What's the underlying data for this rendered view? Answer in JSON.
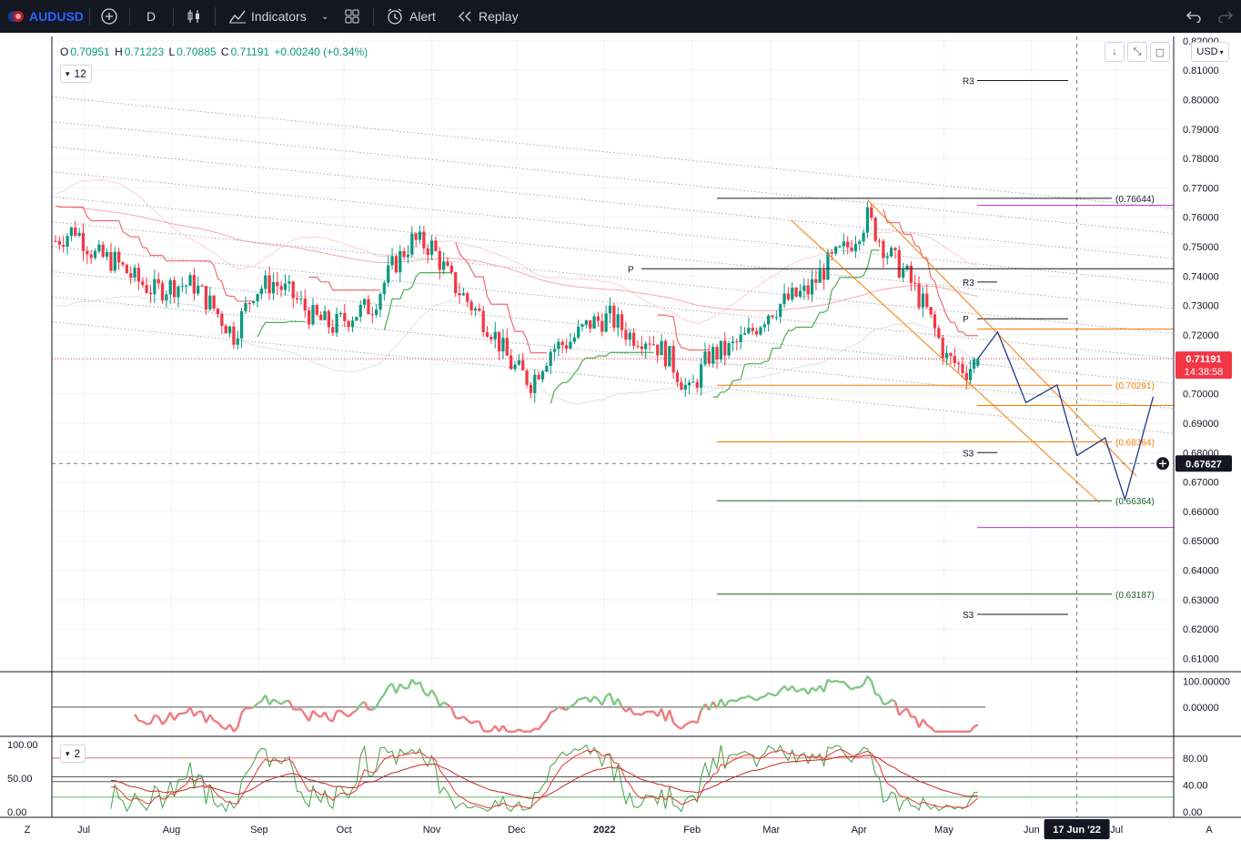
{
  "toolbar": {
    "symbol": "AUDUSD",
    "interval": "D",
    "indicators_label": "Indicators",
    "alert_label": "Alert",
    "replay_label": "Replay"
  },
  "legend": {
    "open_key": "O",
    "open": "0.70951",
    "high_key": "H",
    "high": "0.71223",
    "low_key": "L",
    "low": "0.70885",
    "close_key": "C",
    "close": "0.71191",
    "change": "+0.00240 (+0.34%)",
    "indicator_count": "12",
    "osc2_count": "2"
  },
  "currency": "USD",
  "price_tag": {
    "price": "0.71191",
    "countdown": "14:38:58",
    "color": "#f23645"
  },
  "cursor_tag": {
    "price": "0.67627"
  },
  "date_tag": "17 Jun '22",
  "bottom_letters": {
    "left": "Z",
    "right": "A"
  },
  "colors": {
    "up": "#089981",
    "down": "#f23645",
    "accent": "#2962ff",
    "fib": "#f57c00"
  },
  "chart_data": [
    {
      "type": "line",
      "name_hidden": "",
      "x_ticks": [
        "Jul",
        "Aug",
        "Sep",
        "Oct",
        "Nov",
        "Dec",
        "2022",
        "Feb",
        "Mar",
        "Apr",
        "May",
        "Jun",
        "Jul"
      ],
      "y_ticks": [
        "0.82000",
        "0.81000",
        "0.80000",
        "0.79000",
        "0.78000",
        "0.77000",
        "0.76000",
        "0.75000",
        "0.74000",
        "0.73000",
        "0.72000",
        "0.71000",
        "0.70000",
        "0.69000",
        "0.68000",
        "0.67000",
        "0.66000",
        "0.65000",
        "0.64000",
        "0.63000",
        "0.62000",
        "0.61000"
      ],
      "ylim": [
        0.6055,
        0.8215
      ],
      "close_series": [
        [
          "2021-06-21",
          0.752
        ],
        [
          "2021-06-28",
          0.756
        ],
        [
          "2021-07-05",
          0.747
        ],
        [
          "2021-07-12",
          0.745
        ],
        [
          "2021-07-19",
          0.739
        ],
        [
          "2021-07-26",
          0.735
        ],
        [
          "2021-08-02",
          0.737
        ],
        [
          "2021-08-09",
          0.737
        ],
        [
          "2021-08-16",
          0.729
        ],
        [
          "2021-08-23",
          0.72
        ],
        [
          "2021-08-30",
          0.735
        ],
        [
          "2021-09-06",
          0.738
        ],
        [
          "2021-09-13",
          0.733
        ],
        [
          "2021-09-20",
          0.726
        ],
        [
          "2021-09-27",
          0.723
        ],
        [
          "2021-10-04",
          0.727
        ],
        [
          "2021-10-11",
          0.73
        ],
        [
          "2021-10-18",
          0.743
        ],
        [
          "2021-10-25",
          0.752
        ],
        [
          "2021-11-01",
          0.75
        ],
        [
          "2021-11-08",
          0.738
        ],
        [
          "2021-11-15",
          0.73
        ],
        [
          "2021-11-22",
          0.722
        ],
        [
          "2021-11-29",
          0.71
        ],
        [
          "2021-12-06",
          0.704
        ],
        [
          "2021-12-13",
          0.715
        ],
        [
          "2021-12-20",
          0.718
        ],
        [
          "2021-12-27",
          0.724
        ],
        [
          "2022-01-03",
          0.726
        ],
        [
          "2022-01-10",
          0.72
        ],
        [
          "2022-01-17",
          0.719
        ],
        [
          "2022-01-24",
          0.712
        ],
        [
          "2022-01-31",
          0.7
        ],
        [
          "2022-02-07",
          0.713
        ],
        [
          "2022-02-14",
          0.715
        ],
        [
          "2022-02-21",
          0.72
        ],
        [
          "2022-02-28",
          0.728
        ],
        [
          "2022-03-07",
          0.732
        ],
        [
          "2022-03-14",
          0.735
        ],
        [
          "2022-03-21",
          0.744
        ],
        [
          "2022-03-28",
          0.75
        ],
        [
          "2022-04-04",
          0.76
        ],
        [
          "2022-04-11",
          0.748
        ],
        [
          "2022-04-18",
          0.74
        ],
        [
          "2022-04-25",
          0.728
        ],
        [
          "2022-05-02",
          0.712
        ],
        [
          "2022-05-09",
          0.708
        ],
        [
          "2022-05-13",
          0.7119
        ]
      ],
      "projection": [
        [
          "2022-05-13",
          0.7119
        ],
        [
          "2022-05-20",
          0.721
        ],
        [
          "2022-05-30",
          0.697
        ],
        [
          "2022-06-10",
          0.703
        ],
        [
          "2022-06-17",
          0.679
        ],
        [
          "2022-06-27",
          0.685
        ],
        [
          "2022-07-04",
          0.664
        ],
        [
          "2022-07-14",
          0.699
        ]
      ],
      "levels": [
        {
          "label": "R3",
          "value": 0.8065
        },
        {
          "label": "(0.76644)",
          "value": 0.76644
        },
        {
          "label": "P",
          "value": 0.7425
        },
        {
          "label": "R3",
          "value": 0.738
        },
        {
          "label": "P",
          "value": 0.7255
        },
        {
          "label": "(0.70291)",
          "value": 0.70291
        },
        {
          "label": "(0.68364)",
          "value": 0.68364
        },
        {
          "label": "S3",
          "value": 0.68
        },
        {
          "label": "(0.66364)",
          "value": 0.66364
        },
        {
          "label": "(0.63187)",
          "value": 0.63187
        },
        {
          "label": "S3",
          "value": 0.625
        }
      ]
    },
    {
      "type": "line",
      "y_ticks": [
        "100.00000",
        "0.00000"
      ],
      "ylim": [
        -110,
        130
      ],
      "note_hidden": ""
    },
    {
      "type": "line",
      "y_ticks_left": [
        "100.00",
        "50.00",
        "0.00"
      ],
      "y_ticks_right": [
        "80.00",
        "40.00",
        "0.00"
      ],
      "ylim": [
        0,
        100
      ]
    }
  ]
}
